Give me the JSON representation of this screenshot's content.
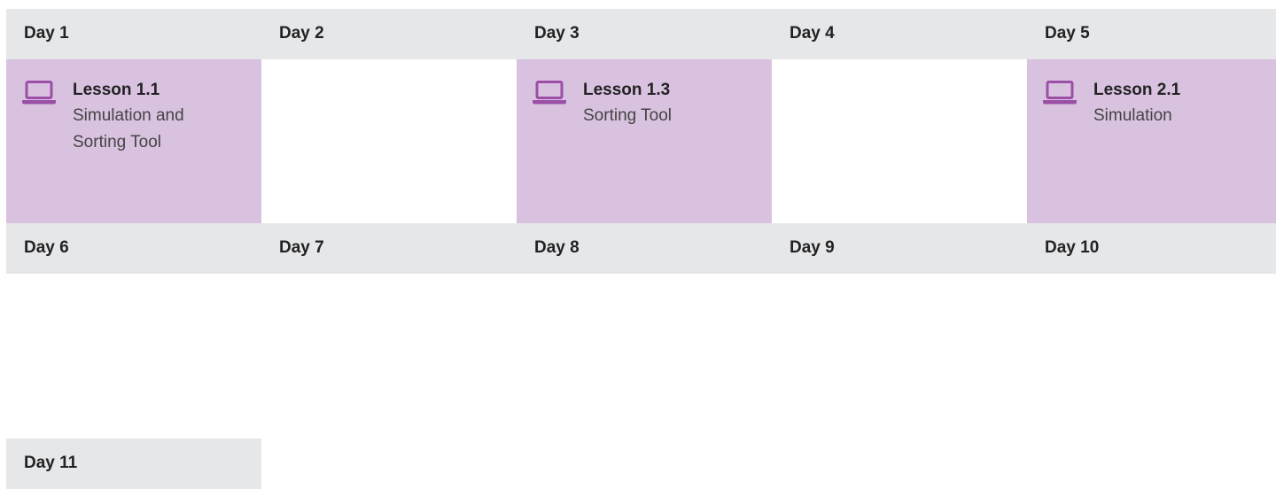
{
  "week1": {
    "days": [
      "Day 1",
      "Day 2",
      "Day 3",
      "Day 4",
      "Day 5"
    ],
    "cells": [
      {
        "title": "Lesson 1.1",
        "desc": "Simulation and Sorting Tool",
        "icon": "laptop-icon"
      },
      null,
      {
        "title": "Lesson 1.3",
        "desc": "Sorting Tool",
        "icon": "laptop-icon"
      },
      null,
      {
        "title": "Lesson 2.1",
        "desc": "Simulation",
        "icon": "laptop-icon"
      }
    ]
  },
  "week2": {
    "days": [
      "Day 6",
      "Day 7",
      "Day 8",
      "Day 9",
      "Day 10"
    ]
  },
  "week3": {
    "days": [
      "Day 11"
    ]
  },
  "colors": {
    "header_bg": "#e6e7e9",
    "lesson_bg": "#d9c2e0",
    "icon": "#9b4fa6"
  }
}
